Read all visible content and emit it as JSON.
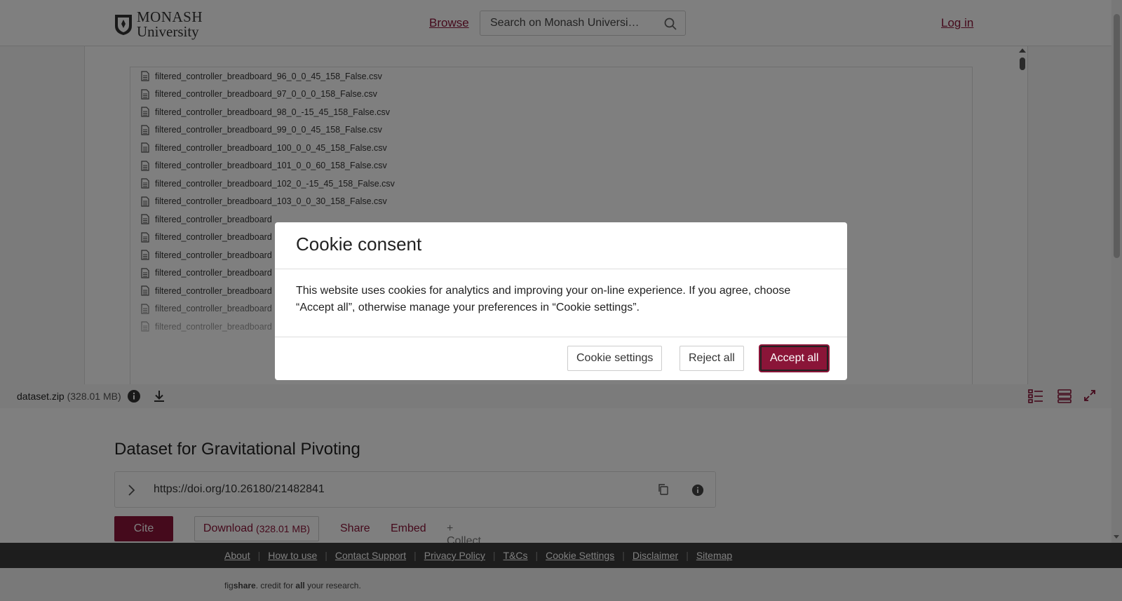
{
  "header": {
    "logo_line1": "MONASH",
    "logo_line2": "University",
    "browse_label": "Browse",
    "search_placeholder": "Search on Monash Universi…",
    "login_label": "Log in"
  },
  "viewer": {
    "files": [
      "filtered_controller_breadboard_96_0_0_45_158_False.csv",
      "filtered_controller_breadboard_97_0_0_0_158_False.csv",
      "filtered_controller_breadboard_98_0_-15_45_158_False.csv",
      "filtered_controller_breadboard_99_0_0_45_158_False.csv",
      "filtered_controller_breadboard_100_0_0_45_158_False.csv",
      "filtered_controller_breadboard_101_0_0_60_158_False.csv",
      "filtered_controller_breadboard_102_0_-15_45_158_False.csv",
      "filtered_controller_breadboard_103_0_0_30_158_False.csv",
      "filtered_controller_breadboard",
      "filtered_controller_breadboard",
      "filtered_controller_breadboard",
      "filtered_controller_breadboard",
      "filtered_controller_breadboard",
      "filtered_controller_breadboard",
      "filtered_controller_breadboard"
    ],
    "file_name": "dataset.zip",
    "file_size": "(328.01 MB)"
  },
  "item": {
    "title": "Dataset for Gravitational Pivoting",
    "doi": "https://doi.org/10.26180/21482841",
    "cite_label": "Cite",
    "download_label": "Download",
    "download_size": "(328.01 MB)",
    "share_label": "Share",
    "embed_label": "Embed",
    "collect_label": "+ Collect"
  },
  "footer": {
    "links": [
      "About",
      "How to use",
      "Contact Support",
      "Privacy Policy",
      "T&Cs",
      "Cookie Settings",
      "Disclaimer",
      "Sitemap"
    ],
    "tagline_a": "fig",
    "tagline_b": "share",
    "tagline_c": ". credit for ",
    "tagline_d": "all",
    "tagline_e": " your research."
  },
  "cookie_modal": {
    "title": "Cookie consent",
    "body": "This website uses cookies for analytics and improving your on-line experience. If you agree, choose “Accept all”, otherwise manage your preferences in “Cookie settings”.",
    "settings_label": "Cookie settings",
    "reject_label": "Reject all",
    "accept_label": "Accept all"
  },
  "colors": {
    "brand": "#8a1538",
    "footer_bg": "#3a3a3a",
    "overlay": "rgba(0,0,0,0.5)"
  },
  "icons": [
    "monash-crest-icon",
    "search-icon",
    "file-icon",
    "info-icon",
    "download-icon",
    "tree-view-icon",
    "list-view-icon",
    "fullscreen-icon",
    "chevron-right-icon",
    "copy-icon"
  ]
}
